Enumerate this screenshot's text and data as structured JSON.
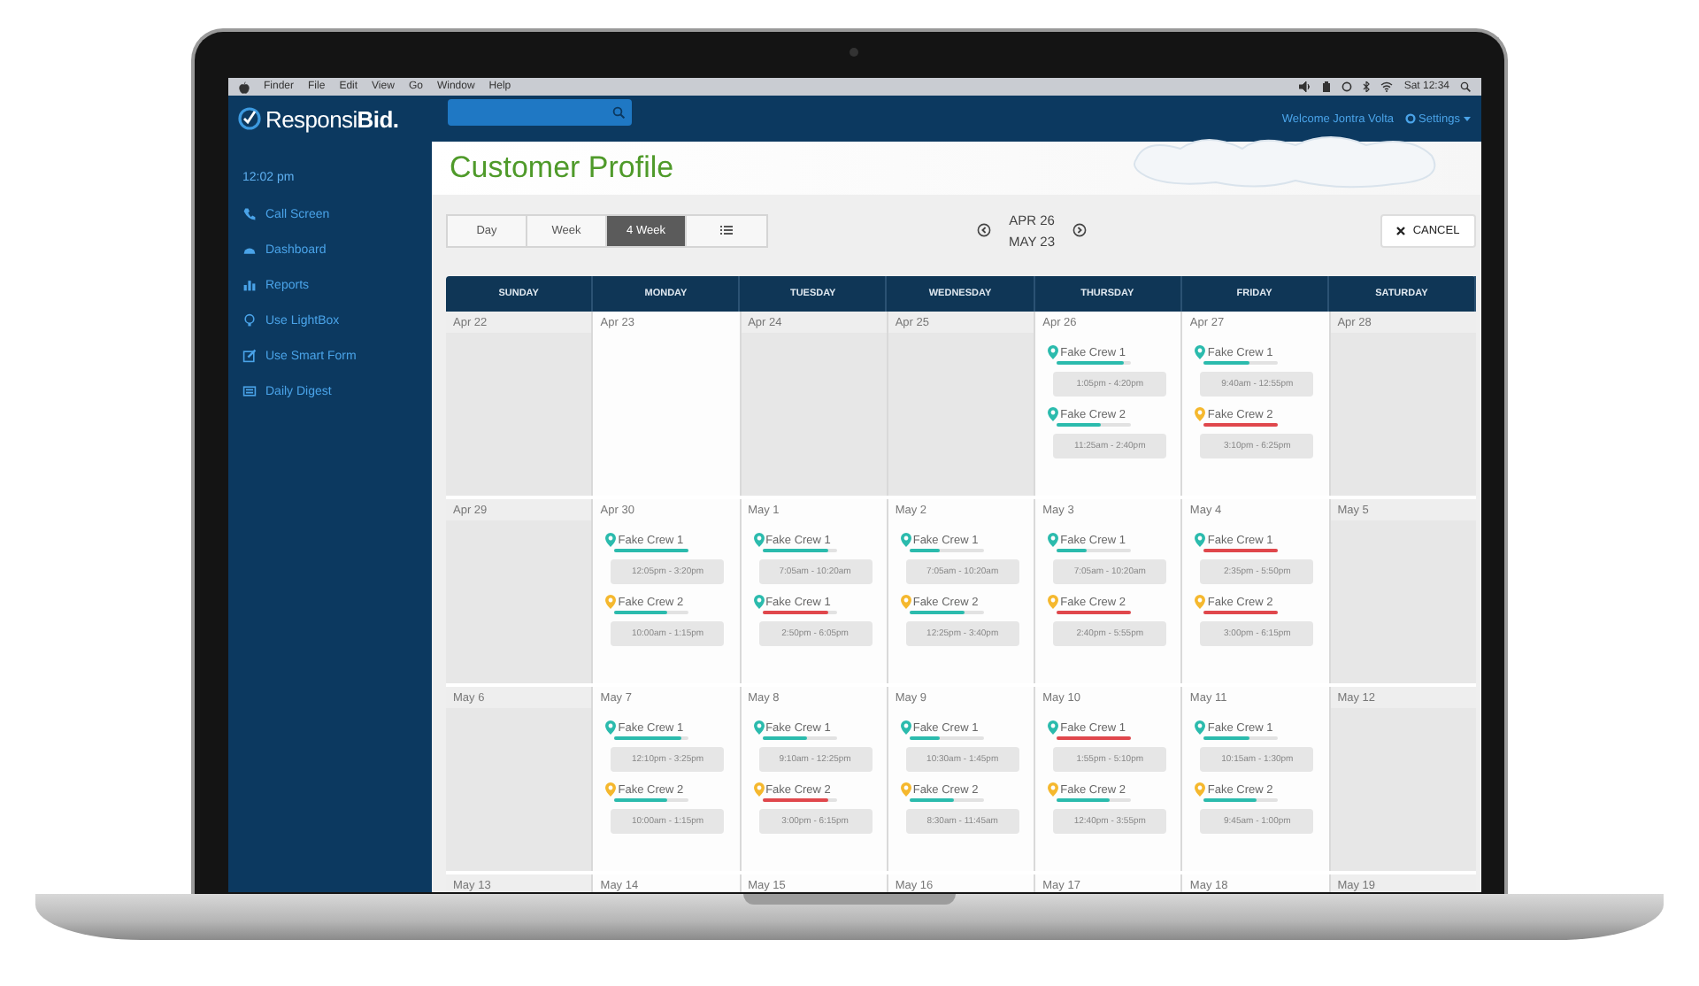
{
  "menu_bar": {
    "items": [
      "Finder",
      "File",
      "Edit",
      "View",
      "Go",
      "Window",
      "Help"
    ],
    "clock": "Sat 12:34"
  },
  "logo": {
    "text_1": "Responsi",
    "text_2": "Bid."
  },
  "header": {
    "welcome": "Welcome Jontra Volta",
    "settings": "Settings"
  },
  "sidebar": {
    "time": "12:02 pm",
    "items": [
      {
        "label": "Call Screen"
      },
      {
        "label": "Dashboard"
      },
      {
        "label": "Reports"
      },
      {
        "label": "Use LightBox"
      },
      {
        "label": "Use Smart Form"
      },
      {
        "label": "Daily Digest"
      }
    ]
  },
  "page": {
    "title": "Customer Profile"
  },
  "view_tabs": [
    {
      "kind": "text",
      "label": "Day",
      "selected": false
    },
    {
      "kind": "text",
      "label": "Week",
      "selected": false
    },
    {
      "kind": "text",
      "label": "4 Week",
      "selected": true
    },
    {
      "kind": "list",
      "selected": false
    }
  ],
  "date_range": {
    "start": "APR 26",
    "end": "MAY 23"
  },
  "cancel_button": "CANCEL",
  "calendar": {
    "days": [
      "SUNDAY",
      "MONDAY",
      "TUESDAY",
      "WEDNESDAY",
      "THURSDAY",
      "FRIDAY",
      "SATURDAY"
    ],
    "weeks": [
      {
        "cells": [
          {
            "date": "Apr 22",
            "shaded": true
          },
          {
            "date": "Apr 23",
            "shaded": false
          },
          {
            "date": "Apr 24",
            "shaded": true
          },
          {
            "date": "Apr 25",
            "shaded": true
          },
          {
            "date": "Apr 26",
            "shaded": false,
            "events": [
              {
                "crew": "Fake Crew 1",
                "color": "#2bbbad",
                "bar": {
                  "color": "#2bbbad",
                  "level": 0.9
                },
                "time": "1:05pm - 4:20pm"
              },
              {
                "crew": "Fake Crew 2",
                "color": "#2bbbad",
                "bar": {
                  "color": "#2bbbad",
                  "level": 0.6
                },
                "time": "11:25am - 2:40pm"
              }
            ]
          },
          {
            "date": "Apr 27",
            "shaded": false,
            "events": [
              {
                "crew": "Fake Crew 1",
                "color": "#2bbbad",
                "bar": {
                  "color": "#2bbbad",
                  "level": 0.6
                },
                "time": "9:40am - 12:55pm"
              },
              {
                "crew": "Fake Crew 2",
                "color": "#f5b82e",
                "bar": {
                  "color": "#e0474c",
                  "level": 1
                },
                "time": "3:10pm - 6:25pm"
              }
            ]
          },
          {
            "date": "Apr 28",
            "shaded": true
          }
        ]
      },
      {
        "cells": [
          {
            "date": "Apr 29",
            "shaded": true
          },
          {
            "date": "Apr 30",
            "shaded": false,
            "events": [
              {
                "crew": "Fake Crew 1",
                "color": "#2bbbad",
                "bar": {
                  "color": "#2bbbad",
                  "level": 1
                },
                "time": "12:05pm - 3:20pm"
              },
              {
                "crew": "Fake Crew 2",
                "color": "#f5b82e",
                "bar": {
                  "color": "#2bbbad",
                  "level": 0.7
                },
                "time": "10:00am - 1:15pm"
              }
            ]
          },
          {
            "date": "May 1",
            "shaded": false,
            "events": [
              {
                "crew": "Fake Crew 1",
                "color": "#2bbbad",
                "bar": {
                  "color": "#2bbbad",
                  "level": 0.9
                },
                "time": "7:05am - 10:20am"
              },
              {
                "crew": "Fake Crew 1",
                "color": "#2bbbad",
                "bar": {
                  "color": "#e0474c",
                  "level": 0.9
                },
                "time": "2:50pm - 6:05pm"
              }
            ]
          },
          {
            "date": "May 2",
            "shaded": false,
            "events": [
              {
                "crew": "Fake Crew 1",
                "color": "#2bbbad",
                "bar": {
                  "color": "#2bbbad",
                  "level": 0.4
                },
                "time": "7:05am - 10:20am"
              },
              {
                "crew": "Fake Crew 2",
                "color": "#f5b82e",
                "bar": {
                  "color": "#2bbbad",
                  "level": 0.75
                },
                "time": "12:25pm - 3:40pm"
              }
            ]
          },
          {
            "date": "May 3",
            "shaded": false,
            "events": [
              {
                "crew": "Fake Crew 1",
                "color": "#2bbbad",
                "bar": {
                  "color": "#2bbbad",
                  "level": 0.4
                },
                "time": "7:05am - 10:20am"
              },
              {
                "crew": "Fake Crew 2",
                "color": "#f5b82e",
                "bar": {
                  "color": "#e0474c",
                  "level": 1
                },
                "time": "2:40pm - 5:55pm"
              }
            ]
          },
          {
            "date": "May 4",
            "shaded": false,
            "events": [
              {
                "crew": "Fake Crew 1",
                "color": "#2bbbad",
                "bar": {
                  "color": "#e0474c",
                  "level": 1
                },
                "time": "2:35pm - 5:50pm"
              },
              {
                "crew": "Fake Crew 2",
                "color": "#f5b82e",
                "bar": {
                  "color": "#e0474c",
                  "level": 1
                },
                "time": "3:00pm - 6:15pm"
              }
            ]
          },
          {
            "date": "May 5",
            "shaded": true
          }
        ]
      },
      {
        "cells": [
          {
            "date": "May 6",
            "shaded": true
          },
          {
            "date": "May 7",
            "shaded": false,
            "events": [
              {
                "crew": "Fake Crew 1",
                "color": "#2bbbad",
                "bar": {
                  "color": "#2bbbad",
                  "level": 0.9
                },
                "time": "12:10pm - 3:25pm"
              },
              {
                "crew": "Fake Crew 2",
                "color": "#f5b82e",
                "bar": {
                  "color": "#2bbbad",
                  "level": 0.7
                },
                "time": "10:00am - 1:15pm"
              }
            ]
          },
          {
            "date": "May 8",
            "shaded": false,
            "events": [
              {
                "crew": "Fake Crew 1",
                "color": "#2bbbad",
                "bar": {
                  "color": "#2bbbad",
                  "level": 0.6
                },
                "time": "9:10am - 12:25pm"
              },
              {
                "crew": "Fake Crew 2",
                "color": "#f5b82e",
                "bar": {
                  "color": "#e0474c",
                  "level": 0.9
                },
                "time": "3:00pm - 6:15pm"
              }
            ]
          },
          {
            "date": "May 9",
            "shaded": false,
            "events": [
              {
                "crew": "Fake Crew 1",
                "color": "#2bbbad",
                "bar": {
                  "color": "#2bbbad",
                  "level": 0.4
                },
                "time": "10:30am - 1:45pm"
              },
              {
                "crew": "Fake Crew 2",
                "color": "#f5b82e",
                "bar": {
                  "color": "#2bbbad",
                  "level": 0.6
                },
                "time": "8:30am - 11:45am"
              }
            ]
          },
          {
            "date": "May 10",
            "shaded": false,
            "events": [
              {
                "crew": "Fake Crew 1",
                "color": "#2bbbad",
                "bar": {
                  "color": "#e0474c",
                  "level": 1
                },
                "time": "1:55pm - 5:10pm"
              },
              {
                "crew": "Fake Crew 2",
                "color": "#f5b82e",
                "bar": {
                  "color": "#2bbbad",
                  "level": 0.7
                },
                "time": "12:40pm - 3:55pm"
              }
            ]
          },
          {
            "date": "May 11",
            "shaded": false,
            "events": [
              {
                "crew": "Fake Crew 1",
                "color": "#2bbbad",
                "bar": {
                  "color": "#2bbbad",
                  "level": 0.6
                },
                "time": "10:15am - 1:30pm"
              },
              {
                "crew": "Fake Crew 2",
                "color": "#f5b82e",
                "bar": {
                  "color": "#2bbbad",
                  "level": 0.7
                },
                "time": "9:45am - 1:00pm"
              }
            ]
          },
          {
            "date": "May 12",
            "shaded": true
          }
        ]
      },
      {
        "cells": [
          {
            "date": "May 13",
            "shaded": true
          },
          {
            "date": "May 14",
            "shaded": false
          },
          {
            "date": "May 15",
            "shaded": false
          },
          {
            "date": "May 16",
            "shaded": false
          },
          {
            "date": "May 17",
            "shaded": false
          },
          {
            "date": "May 18",
            "shaded": false
          },
          {
            "date": "May 19",
            "shaded": true
          }
        ]
      }
    ]
  }
}
